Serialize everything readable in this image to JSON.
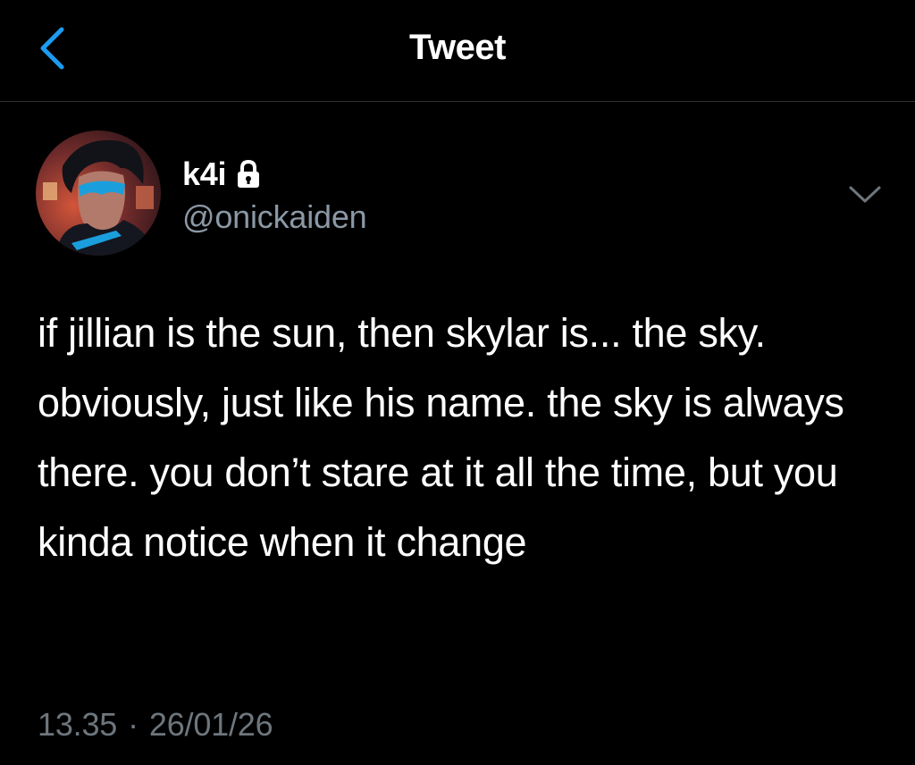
{
  "header": {
    "title": "Tweet",
    "back_icon": "chevron-left-icon",
    "accent_color": "#1d9bf0"
  },
  "tweet": {
    "display_name": "k4i",
    "protected_icon": "lock-icon",
    "handle": "@onickaiden",
    "more_icon": "chevron-down-icon",
    "text": "if jillian is the sun, then skylar is... the sky. obviously, just like his name. the sky is always there. you don’t stare at it all the time, but you kinda notice when it change",
    "time": "13.35",
    "separator": "·",
    "date": "26/01/26"
  },
  "colors": {
    "background": "#000000",
    "text_primary": "#ffffff",
    "text_secondary": "#8b98a5",
    "divider": "#2f3336"
  }
}
